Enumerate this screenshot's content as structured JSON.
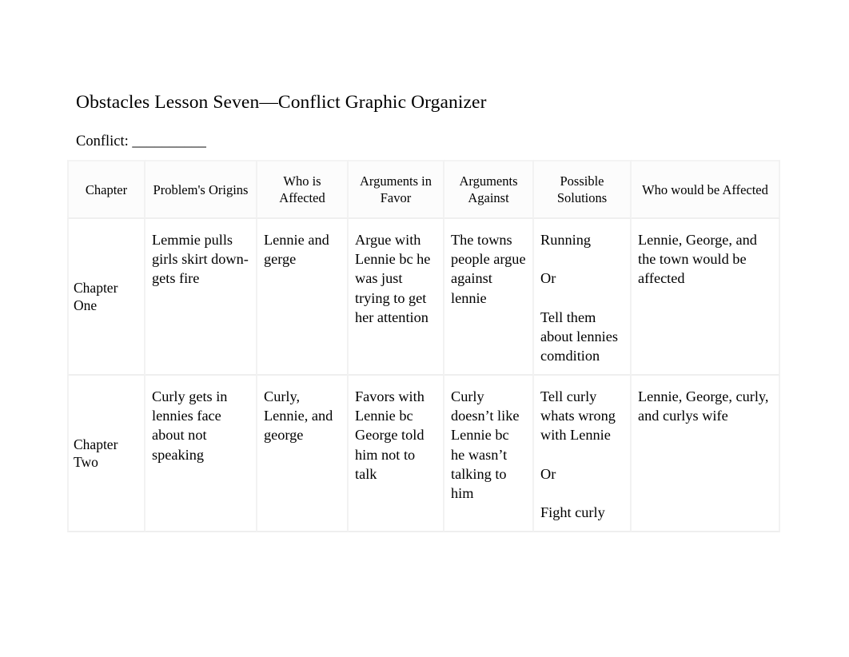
{
  "document": {
    "title": "Obstacles Lesson Seven—Conflict Graphic Organizer",
    "conflict_label": "Conflict:",
    "conflict_blank": "__________"
  },
  "table": {
    "headers": [
      "Chapter",
      "Problem's Origins",
      "Who is Affected",
      "Arguments in Favor",
      "Arguments Against",
      "Possible Solutions",
      "Who would be Affected"
    ],
    "rows": [
      {
        "chapter": "Chapter One",
        "problems_origins": "Lemmie pulls girls skirt down- gets fire",
        "who_is_affected": "Lennie and gerge",
        "arguments_in_favor": "Argue with Lennie bc he was just trying to get her attention",
        "arguments_against": "The towns people argue against lennie",
        "possible_solutions": "Running\n\nOr\n\nTell them about lennies comdition",
        "who_would_be_affected": "Lennie, George, and the town would be affected"
      },
      {
        "chapter": "Chapter Two",
        "problems_origins": "Curly gets in lennies face about not speaking",
        "who_is_affected": "Curly, Lennie, and george",
        "arguments_in_favor": "Favors with Lennie bc George told him not to talk",
        "arguments_against": "Curly doesn’t like Lennie bc he wasn’t talking to him",
        "possible_solutions": "Tell curly whats wrong with Lennie\n\nOr\n\nFight curly",
        "who_would_be_affected": "Lennie, George, curly, and curlys wife"
      }
    ]
  },
  "style": {
    "page_background": "#ffffff",
    "text_color": "#000000",
    "gridline_color": "#f1f1f1",
    "header_background": "#fcfcfc"
  }
}
